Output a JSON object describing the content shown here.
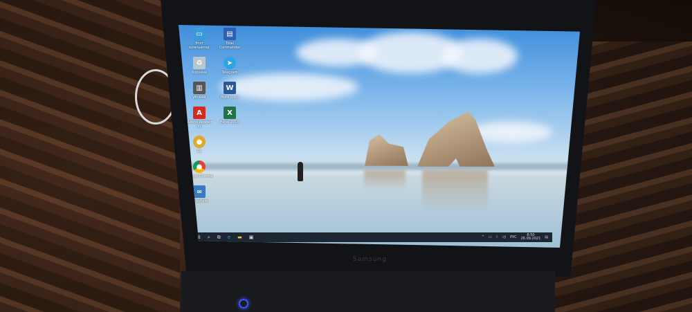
{
  "desktop_icons": [
    {
      "label": "Этот компьютер",
      "icon": "computer-icon",
      "color": "#3a9ad9"
    },
    {
      "label": "Total Commander",
      "icon": "floppy-icon",
      "color": "#2d5fb3"
    },
    {
      "label": "Корзина",
      "icon": "recycle-bin-icon",
      "color": "#b9c6d0"
    },
    {
      "label": "Telegram",
      "icon": "telegram-icon",
      "color": "#2ca5e0"
    },
    {
      "label": "WinRAR",
      "icon": "archive-icon",
      "color": "#555555"
    },
    {
      "label": "Word 2010",
      "icon": "word-icon",
      "color": "#2b579a"
    },
    {
      "label": "Adobe Reader XI",
      "icon": "pdf-icon",
      "color": "#d52b1e"
    },
    {
      "label": "Excel 2010",
      "icon": "excel-icon",
      "color": "#217346"
    },
    {
      "label": "1С",
      "icon": "app-icon",
      "color": "#e0a92a"
    },
    {
      "label": "",
      "icon": "",
      "color": ""
    },
    {
      "label": "Google Chrome",
      "icon": "chrome-icon",
      "color": "#db4437"
    },
    {
      "label": "",
      "icon": "",
      "color": ""
    },
    {
      "label": "Unisphere",
      "icon": "app-icon",
      "color": "#3a7bbf"
    }
  ],
  "taskbar": {
    "start": "⊞",
    "search": "⌕",
    "taskview": "⧉",
    "edge": "e",
    "explorer": "▬",
    "store": "▣",
    "language": "РУС",
    "time": "8:50",
    "date": "26.09.2021",
    "notifications": "▤"
  },
  "laptop_brand": "Samsung"
}
